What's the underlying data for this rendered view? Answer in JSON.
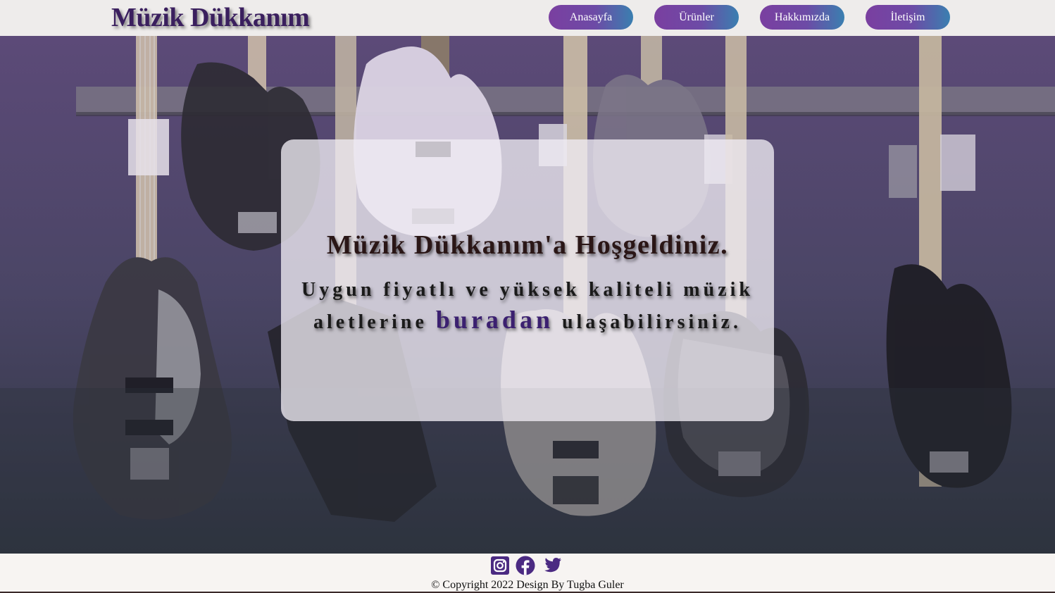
{
  "header": {
    "logo": "Müzik Dükkanım",
    "nav": [
      {
        "label": "Anasayfa"
      },
      {
        "label": "Ürünler"
      },
      {
        "label": "Hakkımızda"
      },
      {
        "label": "İletişim"
      }
    ]
  },
  "hero": {
    "background_image": "bass-guitars-on-wall",
    "title": "Müzik Dükkanım'a Hoşgeldiniz.",
    "text_before": "Uygun fiyatlı ve yüksek kaliteli müzik aletlerine ",
    "link": "buradan",
    "text_after": " ulaşabilirsiniz."
  },
  "footer": {
    "social": [
      {
        "icon": "instagram-icon"
      },
      {
        "icon": "facebook-icon"
      },
      {
        "icon": "twitter-icon"
      }
    ],
    "copyright": "© Copyright 2022 Design By Tugba Guler"
  },
  "colors": {
    "logo": "#3a1f5e",
    "nav_gradient_start": "#7a3fa0",
    "nav_gradient_end": "#3a7fb0",
    "link": "#3b2070",
    "social_icons": "#4b2a82"
  }
}
